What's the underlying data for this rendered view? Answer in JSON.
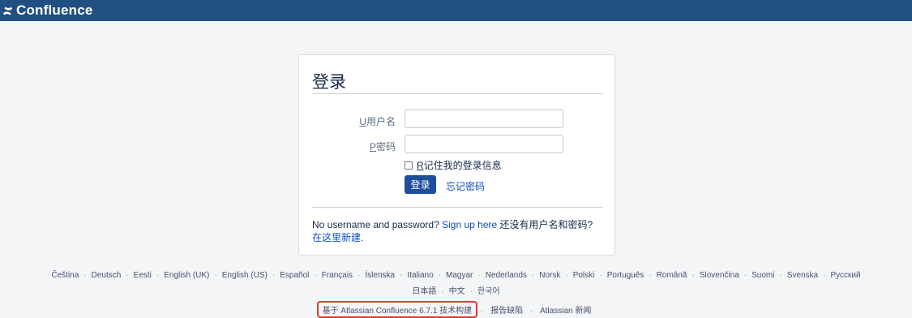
{
  "header": {
    "app_name": "Confluence",
    "logo_icon": "confluence-logo-icon",
    "bg_color": "#205081"
  },
  "login": {
    "title": "登录",
    "username_label_key": "U",
    "username_label": "用户名",
    "password_label_key": "P",
    "password_label": "密码",
    "username_value": "",
    "password_value": "",
    "remember_key": "R",
    "remember_label": "记住我的登录信息",
    "remember_checked": false,
    "login_button": "登录",
    "forgot_link": "忘记密码",
    "no_account_text": "No username and password?",
    "signup_link": "Sign up here",
    "no_account_cn": "还没有用户名和密码?",
    "signup_cn_link": "在这里新建",
    "period": "."
  },
  "languages": {
    "row1": [
      "Čeština",
      "Deutsch",
      "Eesti",
      "English (UK)",
      "English (US)",
      "Español",
      "Français",
      "Íslenska",
      "Italiano",
      "Magyar",
      "Nederlands",
      "Norsk",
      "Polski",
      "Português",
      "Română",
      "Slovenčina",
      "Suomi",
      "Svenska",
      "Русский"
    ],
    "row2": [
      "日本語",
      "中文",
      "한국어"
    ],
    "separator": "·"
  },
  "footer": {
    "powered_by": "基于 Atlassian Confluence 6.7.1 技术构建",
    "report_bug": "报告缺陷",
    "news": "Atlassian 新闻",
    "separator": "·",
    "highlight_color": "#e03a2f"
  }
}
